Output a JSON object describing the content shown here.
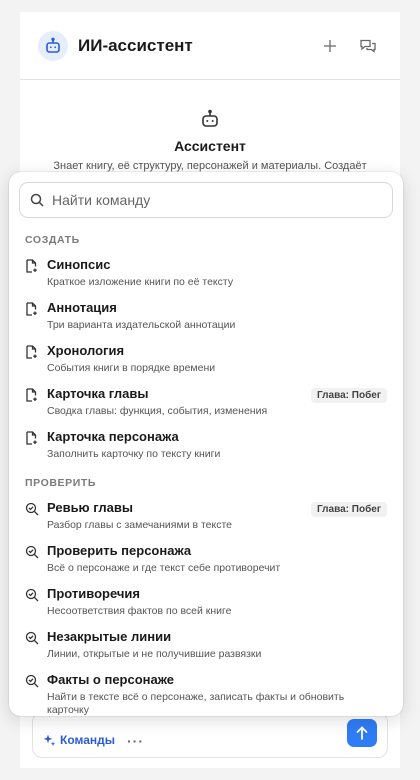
{
  "header": {
    "title": "ИИ-ассистент"
  },
  "intro": {
    "title": "Ассистент",
    "description": "Знает книгу, её структуру, персонажей и материалы. Создаёт"
  },
  "search": {
    "placeholder": "Найти команду"
  },
  "sections": {
    "create": {
      "label": "СОЗДАТЬ",
      "items": [
        {
          "title": "Синопсис",
          "subtitle": "Краткое изложение книги по её тексту",
          "icon": "document-generate-icon"
        },
        {
          "title": "Аннотация",
          "subtitle": "Три варианта издательской аннотации",
          "icon": "document-generate-icon"
        },
        {
          "title": "Хронология",
          "subtitle": "События книги в порядке времени",
          "icon": "document-generate-icon"
        },
        {
          "title": "Карточка главы",
          "subtitle": "Сводка главы: функция, события, изменения",
          "badge": "Глава: Побег",
          "icon": "document-generate-icon"
        },
        {
          "title": "Карточка персонажа",
          "subtitle": "Заполнить карточку по тексту книги",
          "icon": "document-generate-icon"
        }
      ]
    },
    "check": {
      "label": "ПРОВЕРИТЬ",
      "items": [
        {
          "title": "Ревью главы",
          "subtitle": "Разбор главы с замечаниями в тексте",
          "badge": "Глава: Побег",
          "icon": "zoom-check-icon"
        },
        {
          "title": "Проверить персонажа",
          "subtitle": "Всё о персонаже и где текст себе противоречит",
          "icon": "zoom-check-icon"
        },
        {
          "title": "Противоречия",
          "subtitle": "Несоответствия фактов по всей книге",
          "icon": "zoom-check-icon"
        },
        {
          "title": "Незакрытые линии",
          "subtitle": "Линии, открытые и не получившие развязки",
          "icon": "zoom-check-icon"
        },
        {
          "title": "Факты о персонаже",
          "subtitle": "Найти в тексте всё о персонаже, записать факты и обновить карточку",
          "icon": "zoom-check-icon"
        }
      ]
    }
  },
  "composer": {
    "commands_label": "Команды",
    "more_label": "···"
  },
  "colors": {
    "accent": "#2f7cf6",
    "link": "#2a5bd7"
  }
}
